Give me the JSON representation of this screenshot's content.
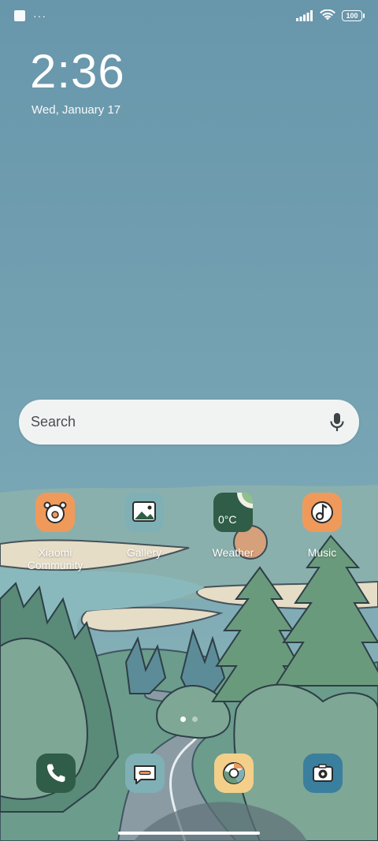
{
  "status_bar": {
    "notification_icon": "app-notification-icon",
    "overflow": "···",
    "signal_icon": "cell-signal-icon",
    "wifi_icon": "wifi-icon",
    "battery": "100"
  },
  "clock": {
    "time": "2:36",
    "date": "Wed, January 17"
  },
  "search": {
    "placeholder": "Search",
    "mic_icon": "microphone-icon"
  },
  "apps": [
    {
      "label": "Xiaomi Community",
      "icon": "community-icon"
    },
    {
      "label": "Gallery",
      "icon": "gallery-icon"
    },
    {
      "label": "Weather",
      "icon": "weather-icon",
      "temperature": "0°C"
    },
    {
      "label": "Music",
      "icon": "music-note-icon"
    }
  ],
  "dock": [
    {
      "icon": "phone-icon"
    },
    {
      "icon": "messages-icon"
    },
    {
      "icon": "google-chrome-icon"
    },
    {
      "icon": "camera-icon"
    }
  ],
  "pager": {
    "pages": 2,
    "current": 1
  },
  "colors": {
    "sky": "#6d9aad",
    "orange_icon": "#ef9a5a",
    "dark_green_icon": "#2f5d47",
    "teal_icon": "#3a7f9e",
    "search_bg": "#f1f3f3"
  }
}
